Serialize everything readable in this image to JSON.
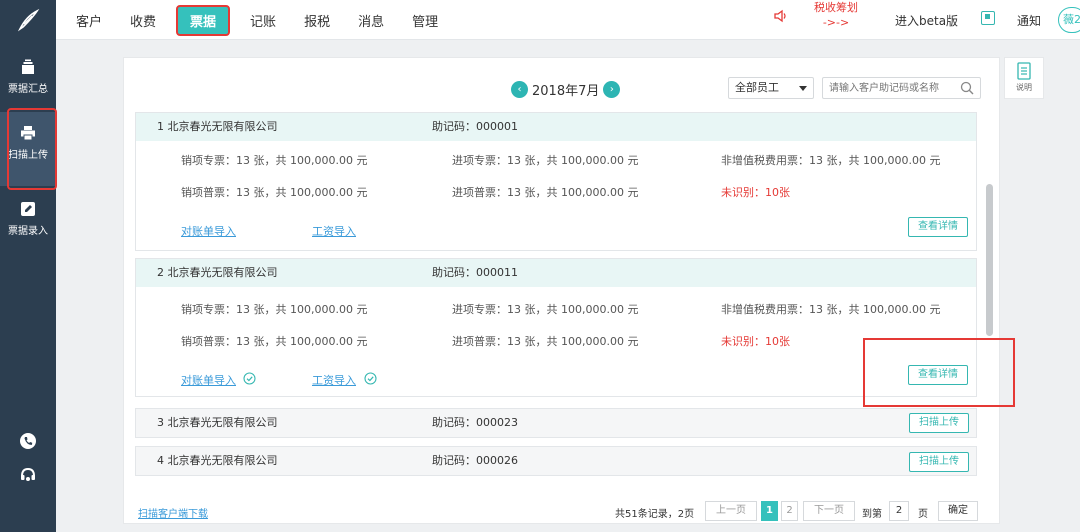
{
  "nav": {
    "items": [
      "客户",
      "收费",
      "票据",
      "记账",
      "报税",
      "消息",
      "管理"
    ],
    "active_index": 2,
    "notice_line1": "税收筹划",
    "notice_line2": "->->",
    "beta": "进入beta版",
    "notify": "通知",
    "avatar": "薇2"
  },
  "sidebar": {
    "items": [
      {
        "label": "票据汇总",
        "icon": "stack-icon"
      },
      {
        "label": "扫描上传",
        "icon": "printer-icon"
      },
      {
        "label": "票据录入",
        "icon": "pencil-icon"
      }
    ],
    "active_index": 1
  },
  "help": {
    "label": "说明"
  },
  "toolbar": {
    "month": "2018年7月",
    "prev": "‹",
    "next": "›",
    "staff_select": "全部员工",
    "search_placeholder": "请输入客户助记码或名称"
  },
  "companies": [
    {
      "title": "1  北京春光无限有限公司",
      "code": "助记码：000001",
      "expanded": true,
      "stats": {
        "xiao_zhuan": "销项专票：13 张，共  100,000.00  元",
        "jin_zhuan": "进项专票：13 张，共  100,000.00  元",
        "fei_zeng": "非增值税费用票：13 张，共  100,000.00  元",
        "xiao_pu": "销项普票：13 张，共  100,000.00  元",
        "jin_pu": "进项普票：13 张，共  100,000.00  元",
        "unrecognized": "未识别：10张"
      },
      "link1": "对账单导入",
      "link2": "工资导入",
      "checked": false,
      "button": "查看详情"
    },
    {
      "title": "2  北京春光无限有限公司",
      "code": "助记码：000011",
      "expanded": true,
      "stats": {
        "xiao_zhuan": "销项专票：13 张，共  100,000.00  元",
        "jin_zhuan": "进项专票：13 张，共  100,000.00  元",
        "fei_zeng": "非增值税费用票：13 张，共  100,000.00  元",
        "xiao_pu": "销项普票：13 张，共  100,000.00  元",
        "jin_pu": "进项普票：13 张，共  100,000.00  元",
        "unrecognized": "未识别：10张"
      },
      "link1": "对账单导入",
      "link2": "工资导入",
      "checked": true,
      "button": "查看详情"
    },
    {
      "title": "3  北京春光无限有限公司",
      "code": "助记码：000023",
      "expanded": false,
      "button": "扫描上传"
    },
    {
      "title": "4  北京春光无限有限公司",
      "code": "助记码：000026",
      "expanded": false,
      "button": "扫描上传"
    }
  ],
  "footer": {
    "download": "扫描客户端下载",
    "total": "共51条记录，2页",
    "prev": "上一页",
    "page1": "1",
    "page2": "2",
    "next": "下一页",
    "goto": "到第",
    "goto_value": "2",
    "page_unit": "页",
    "confirm": "确定"
  },
  "colors": {
    "accent": "#35c1bc",
    "sidebar": "#2c3e50",
    "highlight": "#e53935",
    "link": "#3a9ad9"
  }
}
